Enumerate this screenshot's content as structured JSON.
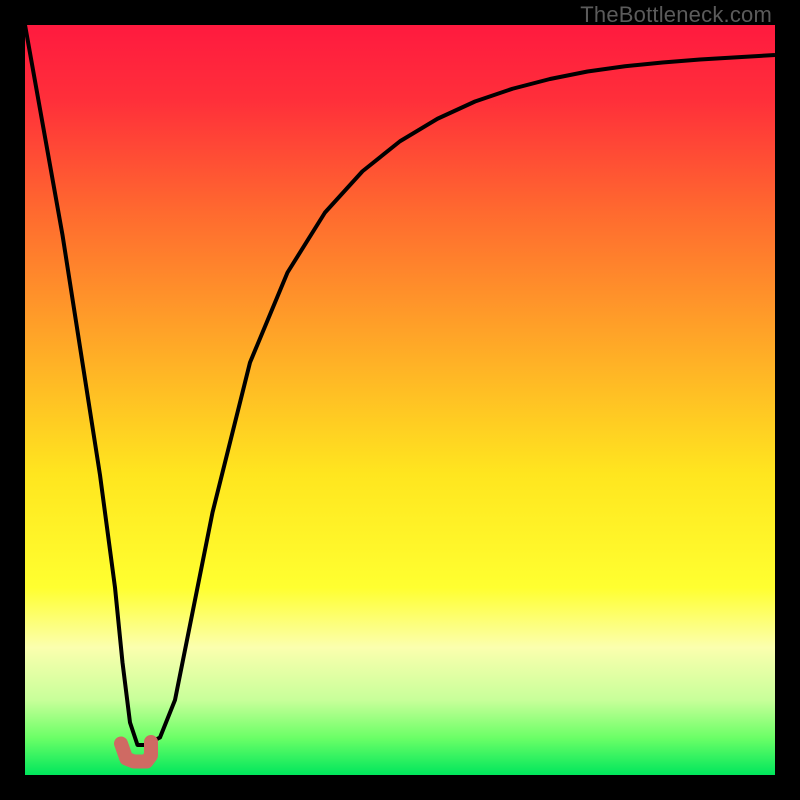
{
  "watermark": "TheBottleneck.com",
  "chart_data": {
    "type": "line",
    "title": "",
    "xlabel": "",
    "ylabel": "",
    "xlim": [
      0,
      100
    ],
    "ylim": [
      0,
      100
    ],
    "grid": false,
    "legend": false,
    "gradient_stops": [
      {
        "offset": 0.0,
        "color": "#ff1a3f"
      },
      {
        "offset": 0.1,
        "color": "#ff2f3a"
      },
      {
        "offset": 0.25,
        "color": "#ff6a2f"
      },
      {
        "offset": 0.45,
        "color": "#ffb126"
      },
      {
        "offset": 0.6,
        "color": "#ffe61f"
      },
      {
        "offset": 0.75,
        "color": "#ffff30"
      },
      {
        "offset": 0.83,
        "color": "#fbffae"
      },
      {
        "offset": 0.9,
        "color": "#c8ff9a"
      },
      {
        "offset": 0.95,
        "color": "#6cff67"
      },
      {
        "offset": 1.0,
        "color": "#00e65c"
      }
    ],
    "series": [
      {
        "name": "curve",
        "stroke": "#000000",
        "stroke_width": 4,
        "x": [
          0,
          5,
          10,
          12,
          13,
          14,
          15,
          16,
          18,
          20,
          22,
          25,
          30,
          35,
          40,
          45,
          50,
          55,
          60,
          65,
          70,
          75,
          80,
          85,
          90,
          95,
          100
        ],
        "values": [
          100,
          72,
          40,
          25,
          15,
          7,
          4,
          4,
          5,
          10,
          20,
          35,
          55,
          67,
          75,
          80.5,
          84.5,
          87.5,
          89.8,
          91.5,
          92.8,
          93.8,
          94.5,
          95.0,
          95.4,
          95.7,
          96.0
        ]
      },
      {
        "name": "marker-band",
        "stroke": "#cf6a63",
        "stroke_width": 14,
        "linecap": "round",
        "x": [
          12.8,
          13.5,
          14.5,
          16.2,
          16.8,
          16.8
        ],
        "values": [
          4.2,
          2.2,
          1.8,
          1.8,
          2.6,
          4.4
        ]
      }
    ]
  }
}
